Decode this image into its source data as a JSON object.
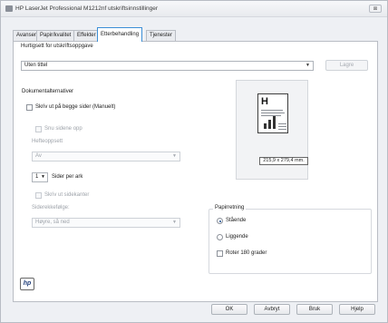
{
  "window": {
    "title": "HP LaserJet Professional M1212nf utskriftsinnstillinger",
    "close_label": "⊠"
  },
  "tabs": [
    "Avansert",
    "Papir/kvalitet",
    "Effekter",
    "Etterbehandling",
    "Tjenester"
  ],
  "active_tab": "Etterbehandling",
  "shortcuts": {
    "label": "Hurtigsett for utskriftsoppgave",
    "value": "Uten tittel",
    "save_button": "Lagre"
  },
  "document_options": {
    "title": "Dokumentalternativer",
    "duplex_label": "Skriv ut på begge sider (Manuelt)",
    "flip_label": "Snu sidene opp",
    "booklet_label": "Heftеoppsett",
    "booklet_value": "Av",
    "pages_per_sheet_value": "1",
    "pages_per_sheet_label": "Sider per ark",
    "borders_label": "Skriv ut sidekanter",
    "page_order_label": "Siderekkefølge:",
    "page_order_value": "Høyre, så ned"
  },
  "preview": {
    "glyph": "H",
    "size_label": "215,9 x 279,4 mm."
  },
  "orientation": {
    "title": "Papirretning",
    "portrait": "Stående",
    "landscape": "Liggende",
    "rotate": "Roter 180 grader",
    "selected": "Stående"
  },
  "logo": {
    "text": "hp"
  },
  "footer": {
    "ok": "OK",
    "cancel": "Avbryt",
    "apply": "Bruk",
    "help": "Hjelp"
  }
}
